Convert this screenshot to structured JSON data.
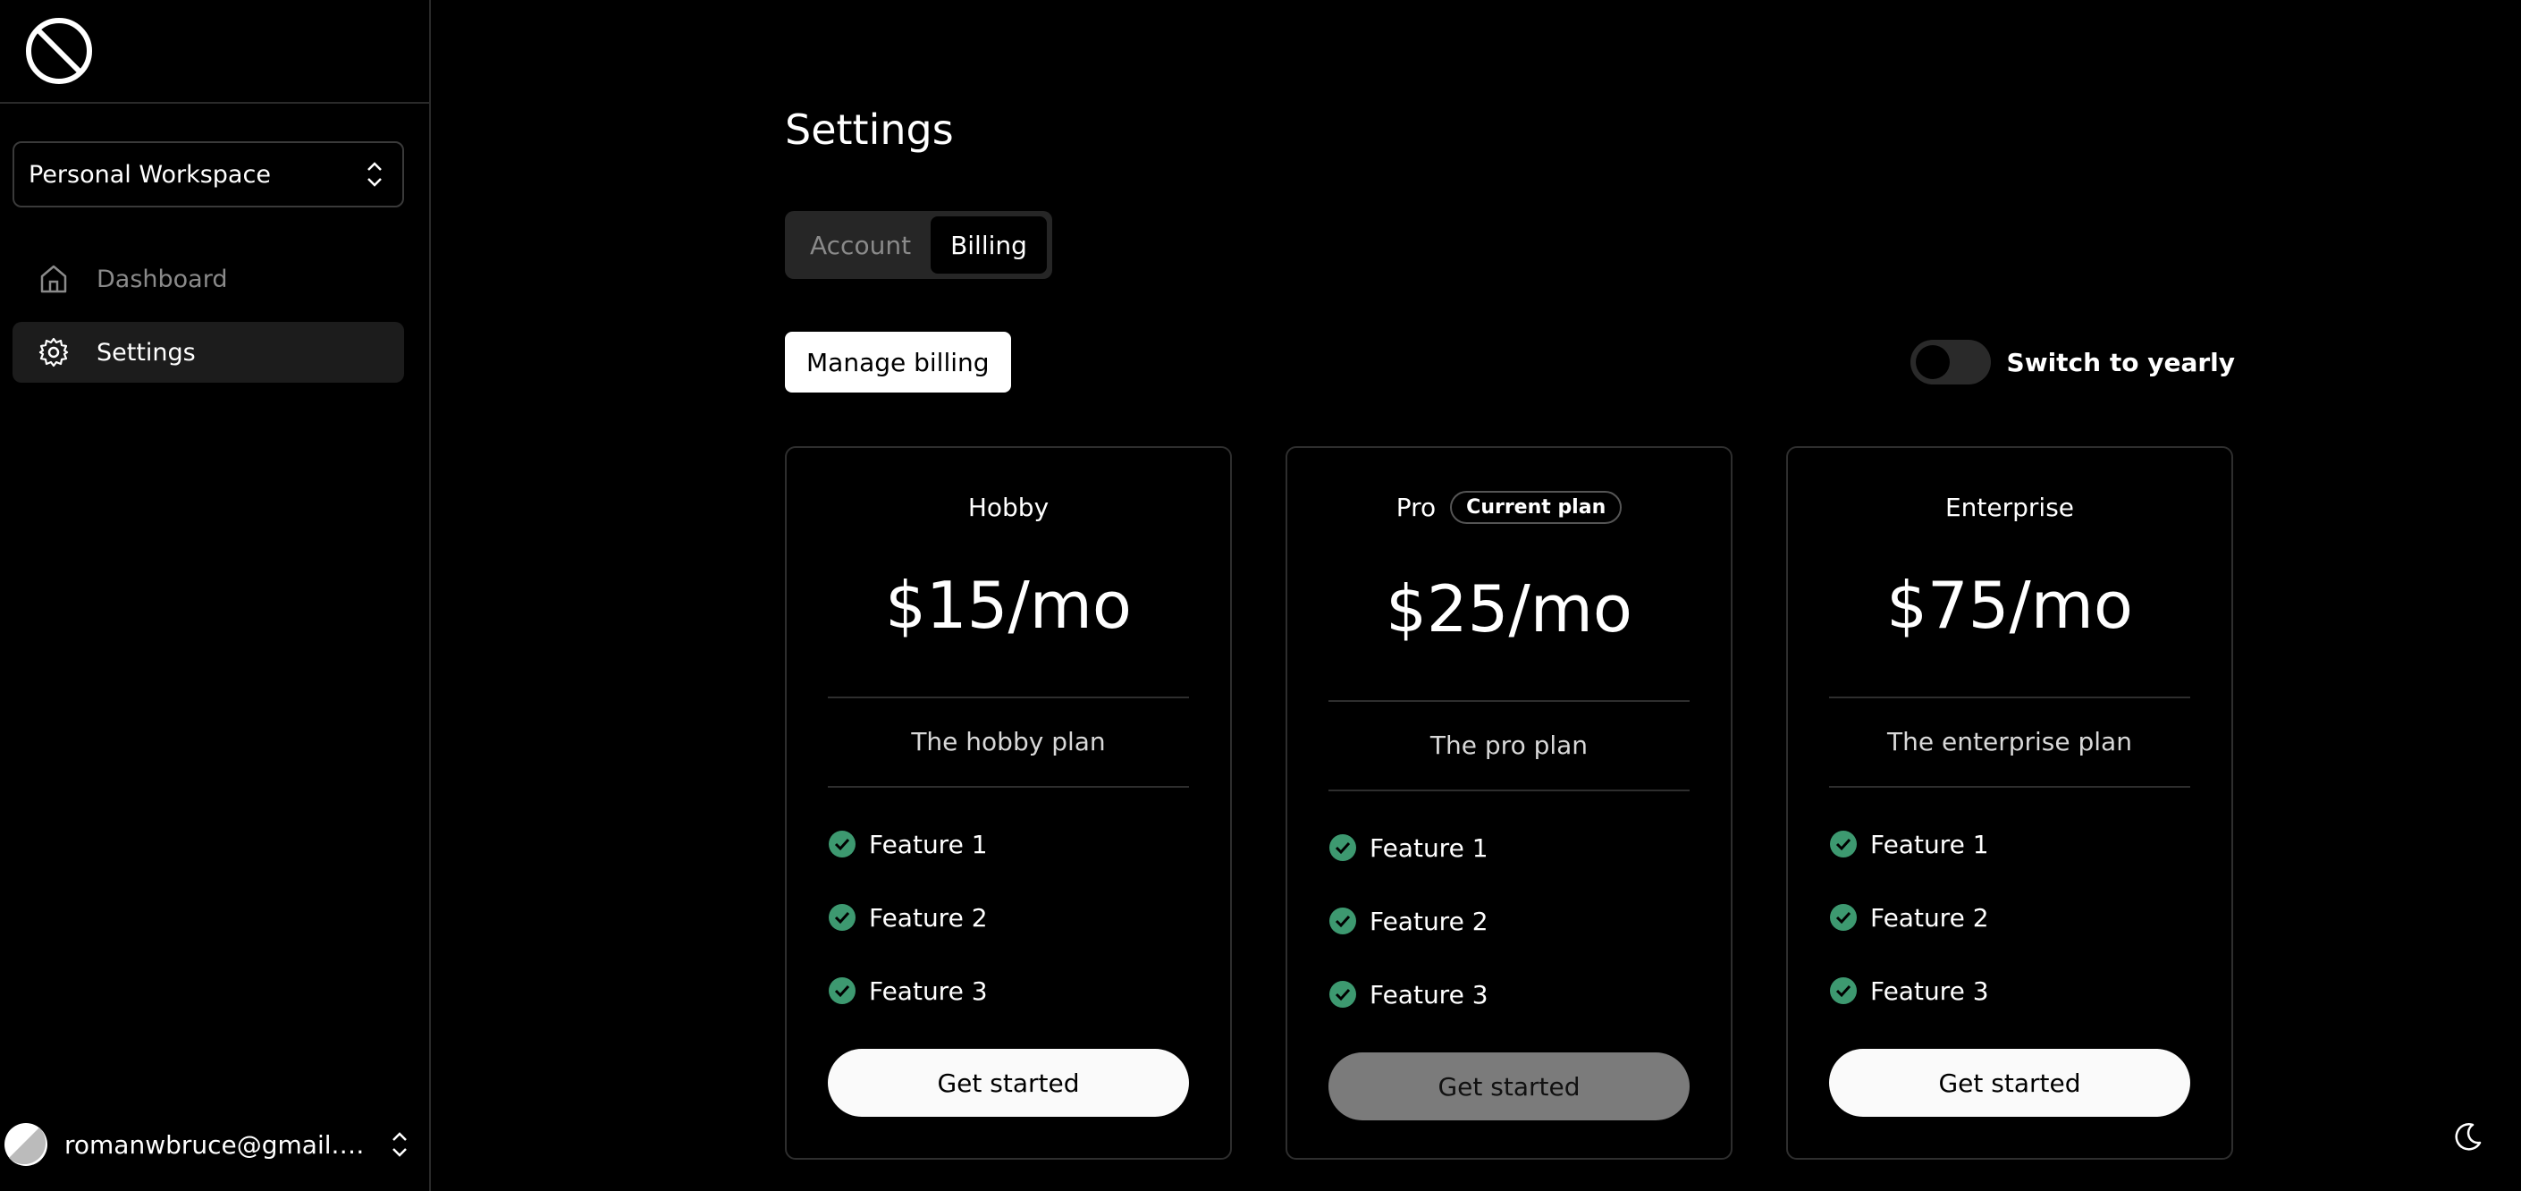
{
  "sidebar": {
    "workspace": "Personal Workspace",
    "nav": [
      {
        "label": "Dashboard",
        "icon": "home-icon",
        "active": false
      },
      {
        "label": "Settings",
        "icon": "gear-icon",
        "active": true
      }
    ],
    "user_email": "romanwbruce@gmail.co…"
  },
  "main": {
    "title": "Settings",
    "tabs": [
      {
        "label": "Account",
        "active": false
      },
      {
        "label": "Billing",
        "active": true
      }
    ],
    "manage_billing": "Manage billing",
    "toggle_label": "Switch to yearly",
    "plans": [
      {
        "name": "Hobby",
        "badge": "",
        "price": "$15/mo",
        "desc": "The hobby plan",
        "features": [
          "Feature 1",
          "Feature 2",
          "Feature 3"
        ],
        "cta": "Get started"
      },
      {
        "name": "Pro",
        "badge": "Current plan",
        "price": "$25/mo",
        "desc": "The pro plan",
        "features": [
          "Feature 1",
          "Feature 2",
          "Feature 3"
        ],
        "cta": "Get started"
      },
      {
        "name": "Enterprise",
        "badge": "",
        "price": "$75/mo",
        "desc": "The enterprise plan",
        "features": [
          "Feature 1",
          "Feature 2",
          "Feature 3"
        ],
        "cta": "Get started"
      }
    ]
  },
  "colors": {
    "check": "#3d9970",
    "accent": "#ffffff"
  }
}
